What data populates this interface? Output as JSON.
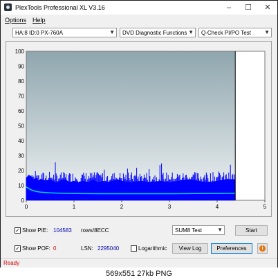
{
  "window": {
    "title": "PlexTools Professional XL V3.16",
    "controls": [
      "–",
      "☐",
      "✕"
    ]
  },
  "menu": {
    "items": [
      "Options",
      "Help"
    ]
  },
  "toolbar": {
    "drive": "HA:8 ID:0  PX-760A",
    "function": "DVD Diagnostic Functions",
    "test": "Q-Check PI/PO Test"
  },
  "chart_data": {
    "type": "area",
    "xlim": [
      0,
      5
    ],
    "ylim": [
      0,
      100
    ],
    "x_ticks": [
      "0",
      "1",
      "2",
      "3",
      "4",
      "5"
    ],
    "y_ticks": [
      "0",
      "10",
      "20",
      "30",
      "40",
      "50",
      "60",
      "70",
      "80",
      "90",
      "100"
    ],
    "end_marker_x": 4.38,
    "series": [
      {
        "x": [
          0.0,
          0.05,
          0.1,
          0.15,
          0.2,
          0.25,
          0.3,
          0.4,
          0.5,
          0.6,
          0.7,
          0.8,
          0.9,
          1.0,
          1.1,
          1.2,
          1.3,
          1.4,
          1.5,
          1.6,
          1.7,
          1.8,
          1.9,
          2.0,
          2.2,
          2.4,
          2.6,
          2.8,
          3.0,
          3.2,
          3.4,
          3.6,
          3.8,
          4.0,
          4.2,
          4.38
        ],
        "values": [
          15,
          17,
          16,
          14,
          15,
          13,
          14,
          13,
          14,
          12,
          13,
          14,
          12,
          13,
          12,
          13,
          12,
          14,
          12,
          13,
          12,
          13,
          14,
          13,
          12,
          13,
          12,
          13,
          12,
          13,
          14,
          13,
          12,
          13,
          14,
          14
        ]
      },
      {
        "x": [
          0.0,
          0.1,
          0.2,
          0.3,
          0.5,
          0.7,
          1.0,
          1.5,
          2.0,
          2.5,
          3.0,
          3.5,
          4.0,
          4.38
        ],
        "values": [
          9,
          7,
          6,
          5.5,
          5,
          4.8,
          4.6,
          4.4,
          4.4,
          4.4,
          4.4,
          4.5,
          4.6,
          4.7
        ]
      }
    ],
    "colors": {
      "area": "#0000ff",
      "avg": "#00d8d8",
      "bg_top": "#8fa6ae",
      "bg_bottom": "#eef2f3",
      "marker": "#000000"
    }
  },
  "stats": {
    "show_pie_label": "Show PIE:",
    "pie_value": "104583",
    "pie_unit": "rows/8ECC",
    "show_pof_label": "Show POF:",
    "pof_value": "0",
    "lsn_label": "LSN:",
    "lsn_value": "2295040",
    "logarithmic_label": "Logarithmic",
    "show_pie_checked": "✓",
    "show_pof_checked": "✓"
  },
  "controls": {
    "test_mode": "SUM8 Test",
    "start": "Start",
    "view_log": "View Log",
    "preferences": "Preferences",
    "info": "i"
  },
  "status": {
    "text": "Ready"
  },
  "caption": {
    "text": "569x551  27kb  PNG"
  }
}
